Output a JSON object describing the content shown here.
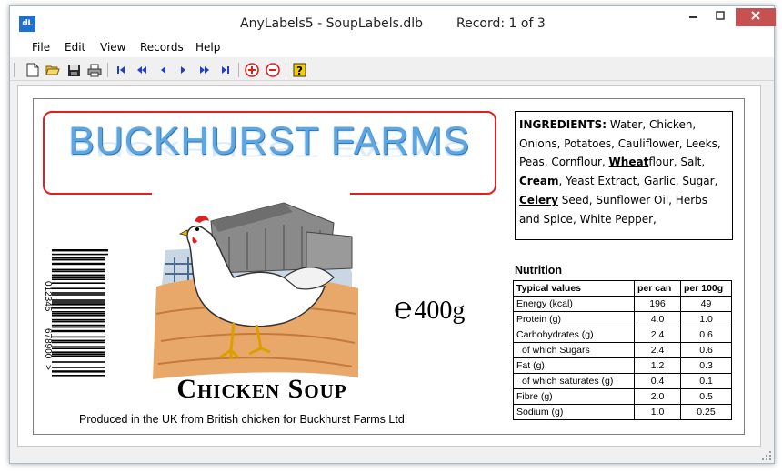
{
  "window": {
    "app_icon": "dL",
    "title": "AnyLabels5 - SoupLabels.dlb",
    "record": "Record: 1 of 3",
    "controls": {
      "minimize": "minimize-icon",
      "maximize": "maximize-icon",
      "close": "close-icon"
    }
  },
  "menu": {
    "file": "File",
    "edit": "Edit",
    "view": "View",
    "records": "Records",
    "help": "Help"
  },
  "toolbar": {
    "icons": [
      "new-icon",
      "open-icon",
      "save-icon",
      "print-icon",
      "first-record-icon",
      "rewind-icon",
      "previous-record-icon",
      "next-record-icon",
      "fast-forward-icon",
      "last-record-icon",
      "add-record-icon",
      "delete-record-icon",
      "help-icon"
    ],
    "colors": {
      "nav": "#1c3fd0",
      "add_delete": "#e02020",
      "help": "#f4d000"
    }
  },
  "label": {
    "brand": "BUCKHURST FARMS",
    "brand_color": "#5ea6e0",
    "barcode_digits": [
      "5",
      "012345",
      "678900",
      ">"
    ],
    "estimated_sign": "℮",
    "weight": "400g",
    "product_name": "Chicken Soup",
    "produced_text": "Produced in the UK from British chicken for Buckhurst Farms Ltd.",
    "ingredients": {
      "heading": "INGREDIENTS:",
      "part1": " Water, Chicken, Onions, Potatoes, Cauliflower, Leeks, Peas, Cornflour, ",
      "allergen1": "Wheat",
      "part2": "flour, Salt, ",
      "allergen2": "Cream",
      "part3": ", Yeast Extract, Garlic, Sugar, ",
      "allergen3": "Celery",
      "part4": " Seed, Sunflower Oil, Herbs and Spice, White Pepper,"
    },
    "nutrition": {
      "title": "Nutrition",
      "headers": [
        "Typical values",
        "per can",
        "per 100g"
      ],
      "rows": [
        [
          "Energy (kcal)",
          "196",
          "49"
        ],
        [
          "Protein (g)",
          "4.0",
          "1.0"
        ],
        [
          "Carbohydrates (g)",
          "2.4",
          "0.6"
        ],
        [
          "of which Sugars",
          "2.4",
          "0.6"
        ],
        [
          "Fat (g)",
          "1.2",
          "0.3"
        ],
        [
          "of which saturates (g)",
          "0.4",
          "0.1"
        ],
        [
          "Fibre (g)",
          "2.0",
          "0.5"
        ],
        [
          "Sodium (g)",
          "1.0",
          "0.25"
        ]
      ]
    }
  }
}
